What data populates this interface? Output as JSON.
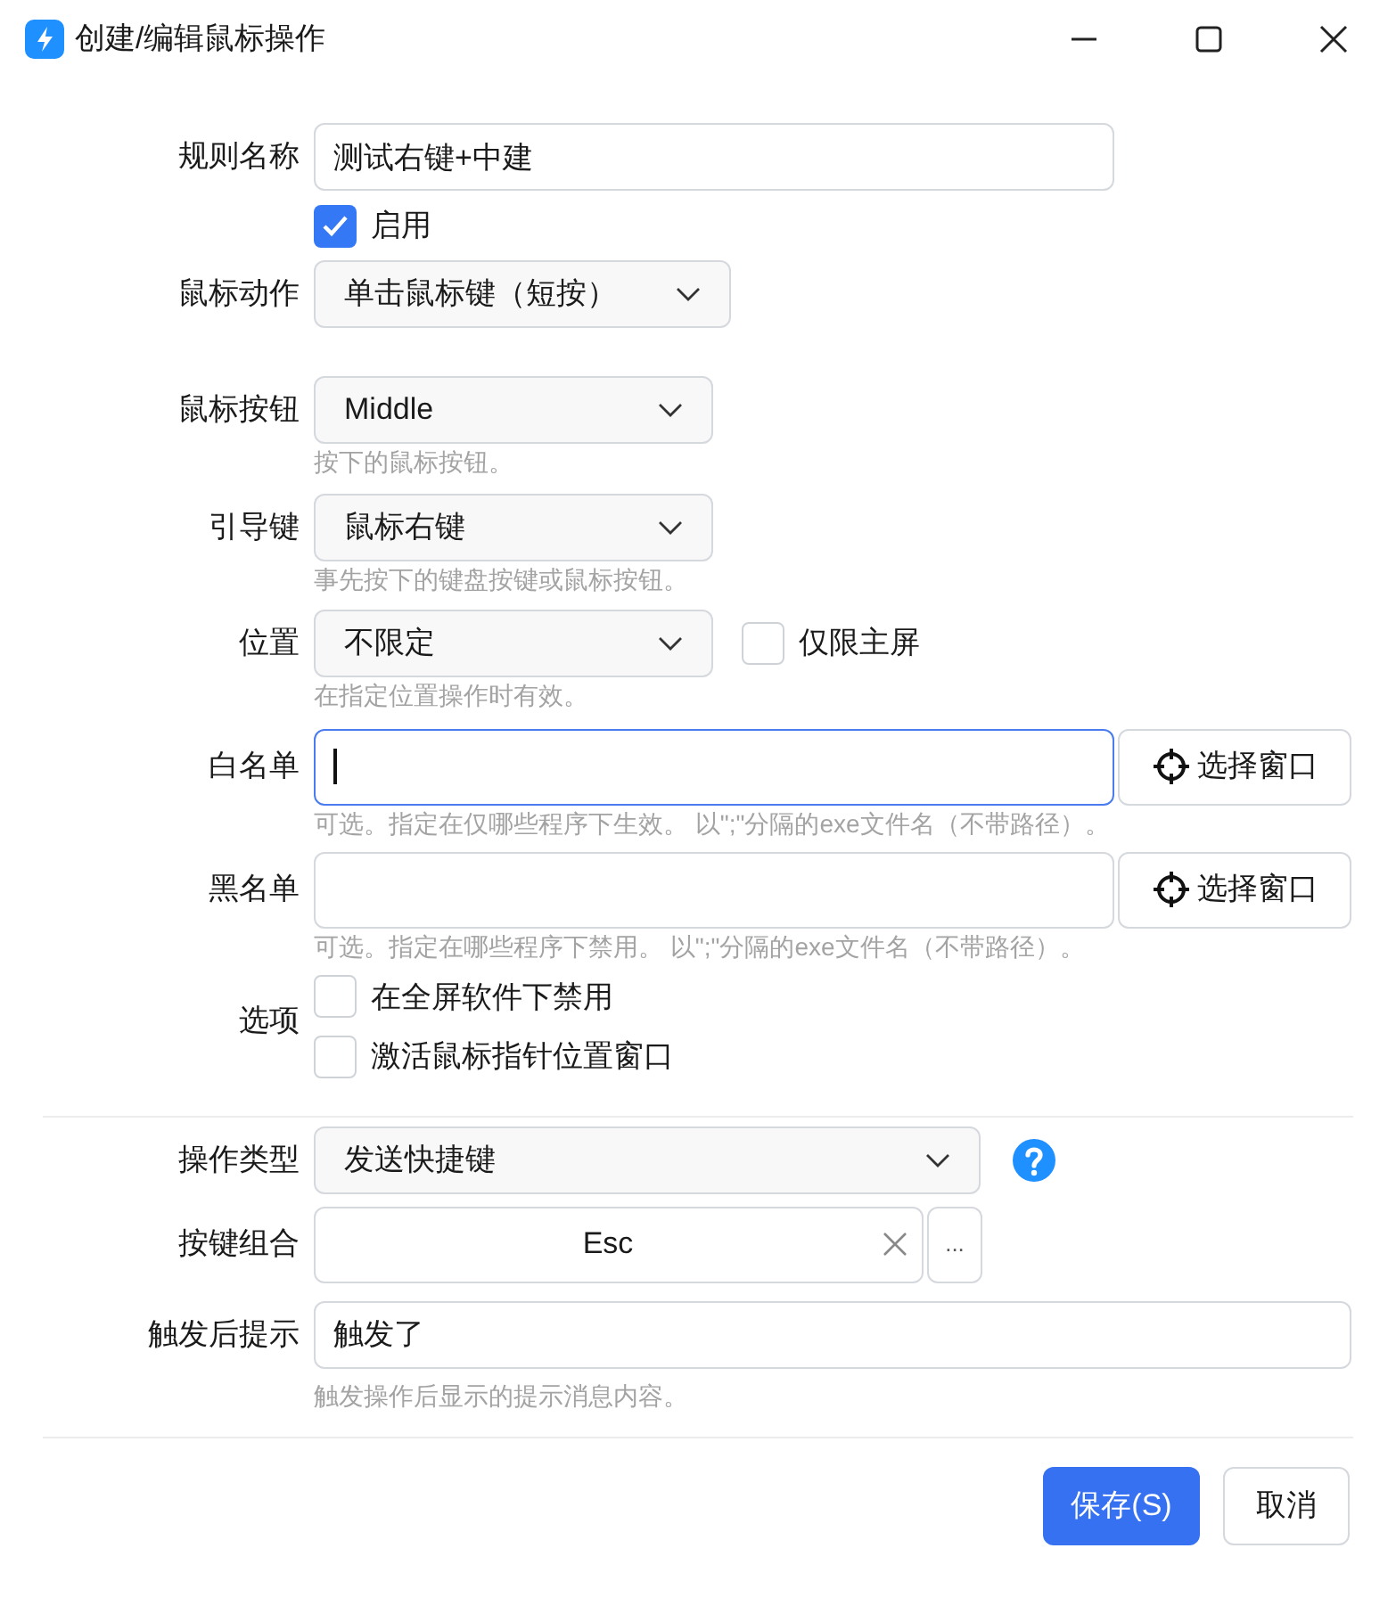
{
  "window": {
    "title": "创建/编辑鼠标操作"
  },
  "rule_name": {
    "label": "规则名称",
    "value": "测试右键+中建"
  },
  "enabled": {
    "label": "启用",
    "checked": true
  },
  "mouse_action": {
    "label": "鼠标动作",
    "value": "单击鼠标键（短按）"
  },
  "mouse_button": {
    "label": "鼠标按钮",
    "value": "Middle",
    "hint": "按下的鼠标按钮。"
  },
  "lead_key": {
    "label": "引导键",
    "value": "鼠标右键",
    "hint": "事先按下的键盘按键或鼠标按钮。"
  },
  "position": {
    "label": "位置",
    "value": "不限定",
    "hint": "在指定位置操作时有效。",
    "primary_only": {
      "label": "仅限主屏",
      "checked": false
    }
  },
  "whitelist": {
    "label": "白名单",
    "focused": true,
    "button": "选择窗口",
    "hint": "可选。指定在仅哪些程序下生效。 以\";\"分隔的exe文件名（不带路径）。"
  },
  "blacklist": {
    "label": "黑名单",
    "focused": false,
    "button": "选择窗口",
    "hint": "可选。指定在哪些程序下禁用。 以\";\"分隔的exe文件名（不带路径）。"
  },
  "options": {
    "label": "选项",
    "items": [
      {
        "label": "在全屏软件下禁用",
        "checked": false
      },
      {
        "label": "激活鼠标指针位置窗口",
        "checked": false
      }
    ]
  },
  "action_type": {
    "label": "操作类型",
    "value": "发送快捷键"
  },
  "key_combo": {
    "label": "按键组合",
    "value": "Esc",
    "more": "..."
  },
  "post_hint": {
    "label": "触发后提示",
    "value": "触发了",
    "hint": "触发操作后显示的提示消息内容。"
  },
  "buttons": [
    {
      "label": "保存(S)",
      "primary": true
    },
    {
      "label": "取消",
      "primary": false
    }
  ]
}
